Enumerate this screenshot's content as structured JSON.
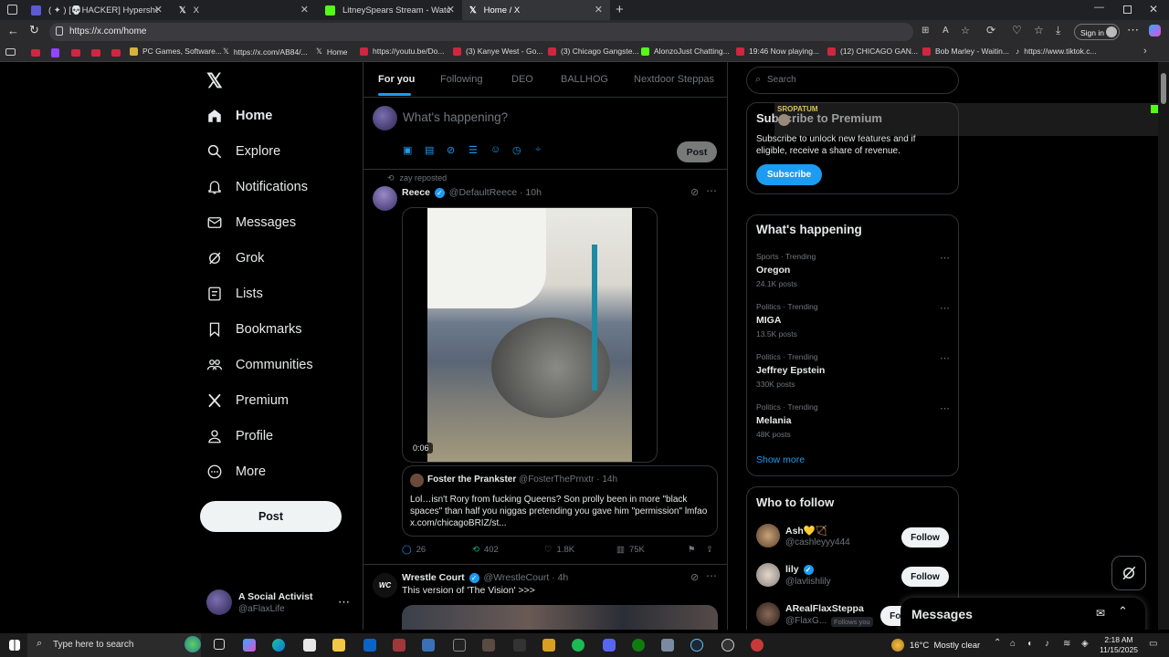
{
  "browser": {
    "tabs": [
      {
        "label": "( ✦ ) [💀HACKER] Hypershot - Ro"
      },
      {
        "label": "X"
      },
      {
        "label": "LitneySpears Stream - Watch Live"
      },
      {
        "label": "Home / X"
      }
    ],
    "url": "https://x.com/home",
    "sign_in": "Sign in",
    "bookmarks": [
      "PC Games, Software...",
      "https://x.com/AB84/...",
      "Home",
      "https://youtu.be/Do...",
      "(3) Kanye West - Go...",
      "(3) Chicago Gangste...",
      "AlonzoJust Chatting...",
      "19:46 Now playing...",
      "(12) CHICAGO GAN...",
      "Bob Marley - Waitin...",
      "https://www.tiktok.c..."
    ]
  },
  "nav": {
    "items": [
      {
        "label": "Home"
      },
      {
        "label": "Explore"
      },
      {
        "label": "Notifications"
      },
      {
        "label": "Messages"
      },
      {
        "label": "Grok"
      },
      {
        "label": "Lists"
      },
      {
        "label": "Bookmarks"
      },
      {
        "label": "Communities"
      },
      {
        "label": "Premium"
      },
      {
        "label": "Profile"
      },
      {
        "label": "More"
      }
    ],
    "post_label": "Post",
    "account_name": "A Social Activist",
    "account_handle": "@aFlaxLife"
  },
  "feed": {
    "tabs": [
      "For you",
      "Following",
      "DEO",
      "BALLHOG",
      "Nextdoor Steppas"
    ],
    "compose_placeholder": "What's happening?",
    "compose_post": "Post",
    "tweet1": {
      "reposted_by": "zay reposted",
      "name": "Reece",
      "handle": "@DefaultReece",
      "time": "· 10h",
      "video_time": "0:06",
      "quote_name": "Foster the Prankster",
      "quote_handle": "@FosterThePrnxtr",
      "quote_time": "· 14h",
      "quote_text": "Lol…isn't Rory from fucking Queens? Son prolly been in more \"black spaces\" than half you niggas pretending you gave him \"permission\" lmfao x.com/chicagoBRIZ/st...",
      "replies": "26",
      "reposts": "402",
      "likes": "1.8K",
      "views": "75K"
    },
    "tweet2": {
      "name": "Wrestle Court",
      "handle": "@WrestleCourt",
      "time": "· 4h",
      "text": "This version of 'The Vision' >>>"
    }
  },
  "right": {
    "search_placeholder": "Search",
    "premium_title": "Subscribe to Premium",
    "overlay_label": "SROPATUM",
    "premium_text": "Subscribe to unlock new features and if eligible, receive a share of revenue.",
    "subscribe": "Subscribe",
    "happening_title": "What's happening",
    "trends": [
      {
        "category": "Sports · Trending",
        "name": "Oregon",
        "count": "24.1K posts"
      },
      {
        "category": "Politics · Trending",
        "name": "MIGA",
        "count": "13.5K posts"
      },
      {
        "category": "Politics · Trending",
        "name": "Jeffrey Epstein",
        "count": "330K posts"
      },
      {
        "category": "Politics · Trending",
        "name": "Melania",
        "count": "48K posts"
      }
    ],
    "show_more": "Show more",
    "who_title": "Who to follow",
    "follow": [
      {
        "name": "Ash💛🏹",
        "handle": "@cashleyyy444",
        "button": "Follow"
      },
      {
        "name": "lily",
        "handle": "@lavlishlily",
        "button": "Follow"
      },
      {
        "name": "ARealFlaxSteppa",
        "handle": "@FlaxG...",
        "badge": "Follows you",
        "button": "Follow"
      }
    ],
    "messages": "Messages"
  },
  "taskbar": {
    "search": "Type here to search",
    "weather": "16°C  Mostly clear",
    "time": "2:18 AM",
    "date": "11/15/2025"
  }
}
